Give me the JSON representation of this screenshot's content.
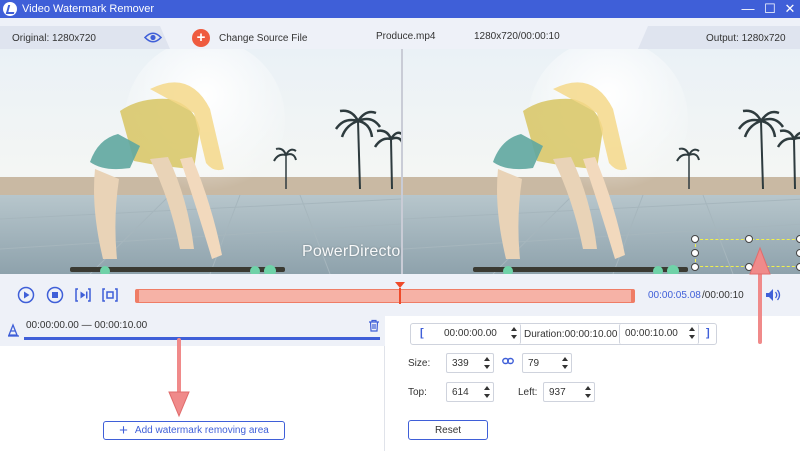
{
  "window": {
    "title": "Video Watermark Remover",
    "minimize_glyph": "—",
    "maximize_glyph": "☐",
    "close_glyph": "✕"
  },
  "infobar": {
    "original_label": "Original: 1280x720",
    "change_source_label": "Change Source File",
    "file_name": "Produce.mp4",
    "file_info": "1280x720/00:00:10",
    "output_label": "Output: 1280x720"
  },
  "preview": {
    "watermark_text": "PowerDirector"
  },
  "playback": {
    "current_time": "00:00:05.08",
    "total_time": "/00:00:10"
  },
  "clip": {
    "range_text": "00:00:00.00 — 00:00:10.00"
  },
  "add_area_label": "Add watermark removing area",
  "range_editor": {
    "start_open": "[",
    "start_time": "00:00:00.00",
    "duration_label": "Duration:00:00:10.00",
    "end_time": "00:00:10.00",
    "end_close": "]"
  },
  "size": {
    "label": "Size:",
    "width": "339",
    "height": "79"
  },
  "position": {
    "top_label": "Top:",
    "top": "614",
    "left_label": "Left:",
    "left": "937"
  },
  "reset_label": "Reset",
  "colors": {
    "accent": "#3f5fd8",
    "timeline_fill": "#f6b2a6",
    "playhead": "#ef4a2a",
    "change_button": "#ef5b3f",
    "annotation_arrow": "#f08a8a",
    "selection_box": "#f2f24a"
  }
}
